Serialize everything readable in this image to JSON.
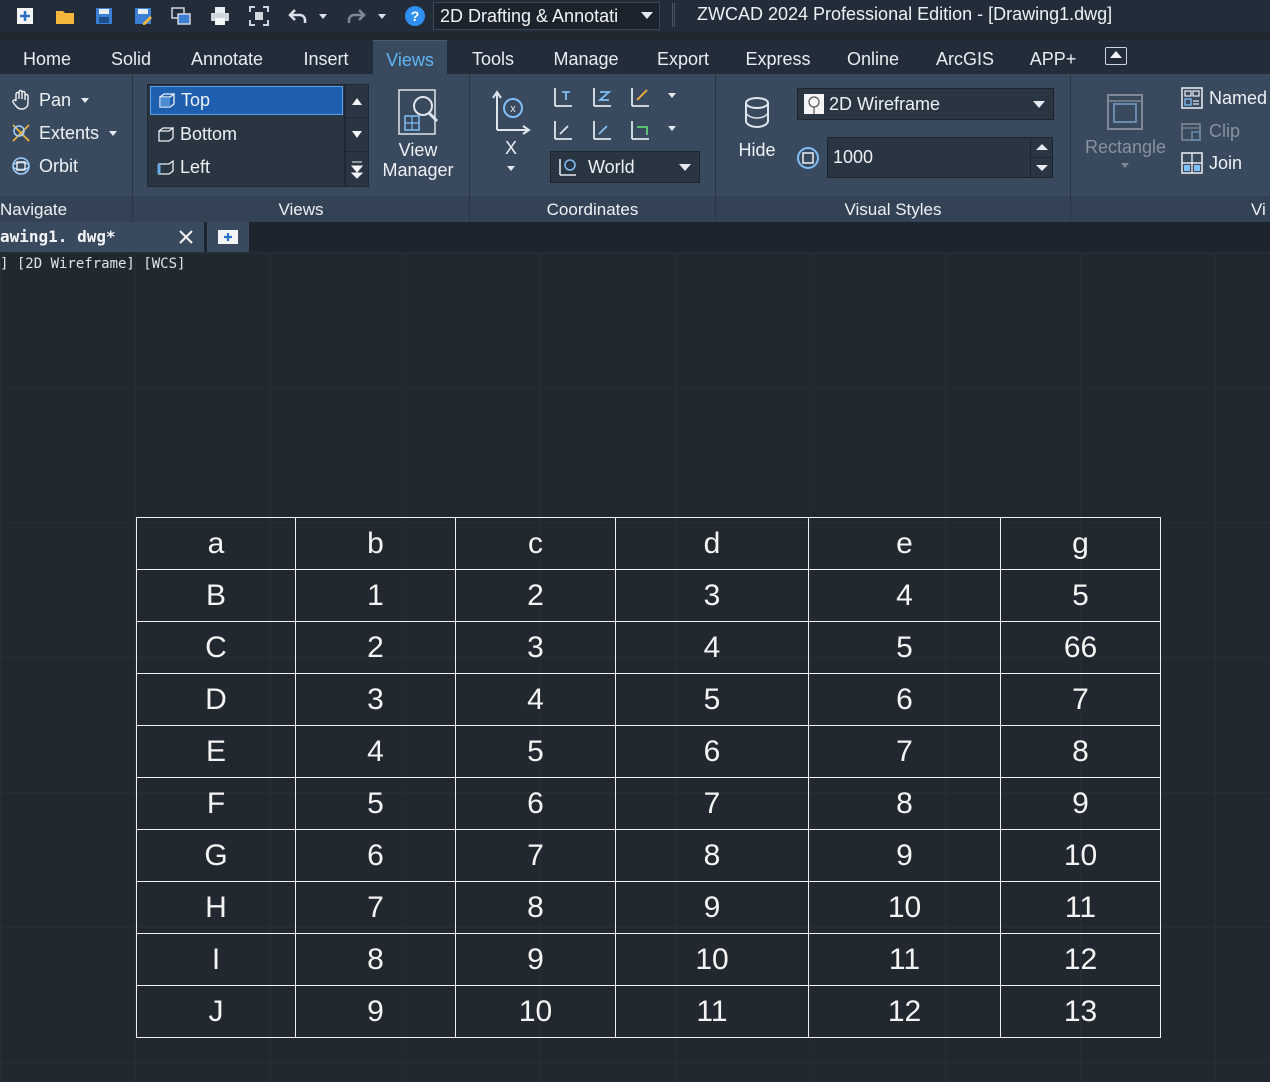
{
  "titlebar": {
    "quick_access_icons": [
      "new-icon",
      "open-folder-icon",
      "save-icon",
      "save-as-icon",
      "window-icon",
      "print-icon",
      "zoom-extents-icon",
      "undo-icon",
      "undo-dropdown-icon",
      "redo-icon",
      "redo-dropdown-icon",
      "help-icon"
    ],
    "workspace": "2D Drafting & Annotati",
    "app_title": "ZWCAD 2024 Professional Edition - [Drawing1.dwg]"
  },
  "menu": {
    "tabs": [
      {
        "label": "Home"
      },
      {
        "label": "Solid"
      },
      {
        "label": "Annotate"
      },
      {
        "label": "Insert"
      },
      {
        "label": "Views",
        "active": true
      },
      {
        "label": "Tools"
      },
      {
        "label": "Manage"
      },
      {
        "label": "Export"
      },
      {
        "label": "Express"
      },
      {
        "label": "Online"
      },
      {
        "label": "ArcGIS"
      },
      {
        "label": "APP+"
      }
    ]
  },
  "ribbon": {
    "navigate": {
      "label": "Navigate",
      "pan": "Pan",
      "extents": "Extents",
      "orbit": "Orbit"
    },
    "views": {
      "label": "Views",
      "items": [
        "Top",
        "Bottom",
        "Left"
      ],
      "selected": "Top",
      "view_manager_line1": "View",
      "view_manager_line2": "Manager"
    },
    "coordinates": {
      "label": "Coordinates",
      "x_button": "X",
      "ucs_value": "World"
    },
    "visual_styles": {
      "label": "Visual Styles",
      "hide": "Hide",
      "style_value": "2D Wireframe",
      "face_value": "1000"
    },
    "viewports": {
      "label": "Vi",
      "rectangle": "Rectangle",
      "named": "Named",
      "clip": "Clip",
      "join": "Join"
    }
  },
  "document": {
    "tab_label": "awing1. dwg*",
    "viewport_label": "] [2D Wireframe] [WCS]"
  },
  "table": {
    "rows": [
      [
        "a",
        "b",
        "c",
        "d",
        "e",
        "g"
      ],
      [
        "B",
        "1",
        "2",
        "3",
        "4",
        "5"
      ],
      [
        "C",
        "2",
        "3",
        "4",
        "5",
        "66"
      ],
      [
        "D",
        "3",
        "4",
        "5",
        "6",
        "7"
      ],
      [
        "E",
        "4",
        "5",
        "6",
        "7",
        "8"
      ],
      [
        "F",
        "5",
        "6",
        "7",
        "8",
        "9"
      ],
      [
        "G",
        "6",
        "7",
        "8",
        "9",
        "10"
      ],
      [
        "H",
        "7",
        "8",
        "9",
        "10",
        "11"
      ],
      [
        "I",
        "8",
        "9",
        "10",
        "11",
        "12"
      ],
      [
        "J",
        "9",
        "10",
        "11",
        "12",
        "13"
      ]
    ]
  },
  "colors": {
    "accent": "#5fb5f5",
    "ribbon": "#3a4a5e",
    "canvas": "#212830",
    "selected": "#1f5fb0"
  }
}
